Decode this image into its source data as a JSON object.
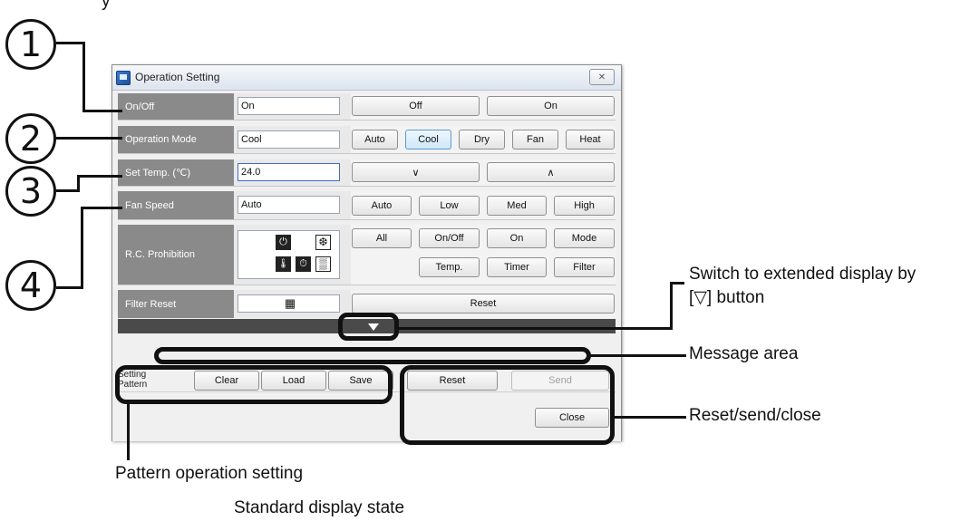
{
  "window": {
    "title": "Operation Setting",
    "close_glyph": "✕"
  },
  "rows": {
    "onoff": {
      "label": "On/Off",
      "value": "On",
      "buttons": [
        "Off",
        "On"
      ]
    },
    "mode": {
      "label": "Operation Mode",
      "value": "Cool",
      "buttons": [
        "Auto",
        "Cool",
        "Dry",
        "Fan",
        "Heat"
      ],
      "active": "Cool"
    },
    "temp": {
      "label": "Set Temp. (℃)",
      "value": "24.0",
      "down_label": "∨",
      "up_label": "∧"
    },
    "fan": {
      "label": "Fan Speed",
      "value": "Auto",
      "buttons": [
        "Auto",
        "Low",
        "Med",
        "High"
      ]
    },
    "prohibition": {
      "label": "R.C. Prohibition",
      "buttons_top": [
        "All",
        "On/Off",
        "On",
        "Mode"
      ],
      "buttons_bottom": [
        "Temp.",
        "Timer",
        "Filter"
      ],
      "icon_glyphs": [
        "⏻",
        "❆",
        "🌡",
        "⏱",
        "▒"
      ]
    },
    "filter": {
      "label": "Filter Reset",
      "button": "Reset",
      "icon_glyph": "▦"
    }
  },
  "bottom": {
    "pattern_label_line1": "Setting",
    "pattern_label_line2": "Pattern",
    "clear": "Clear",
    "load": "Load",
    "save": "Save",
    "reset": "Reset",
    "send": "Send",
    "close": "Close"
  },
  "annotations": {
    "num1": "1",
    "num2": "2",
    "num3": "3",
    "num4": "4",
    "extended_line1": "Switch to extended display by",
    "extended_line2": "[▽] button",
    "message_area": "Message area",
    "reset_send_close": "Reset/send/close",
    "pattern_op": "Pattern operation setting",
    "caption": "Standard display state",
    "top_fragment": "y"
  }
}
